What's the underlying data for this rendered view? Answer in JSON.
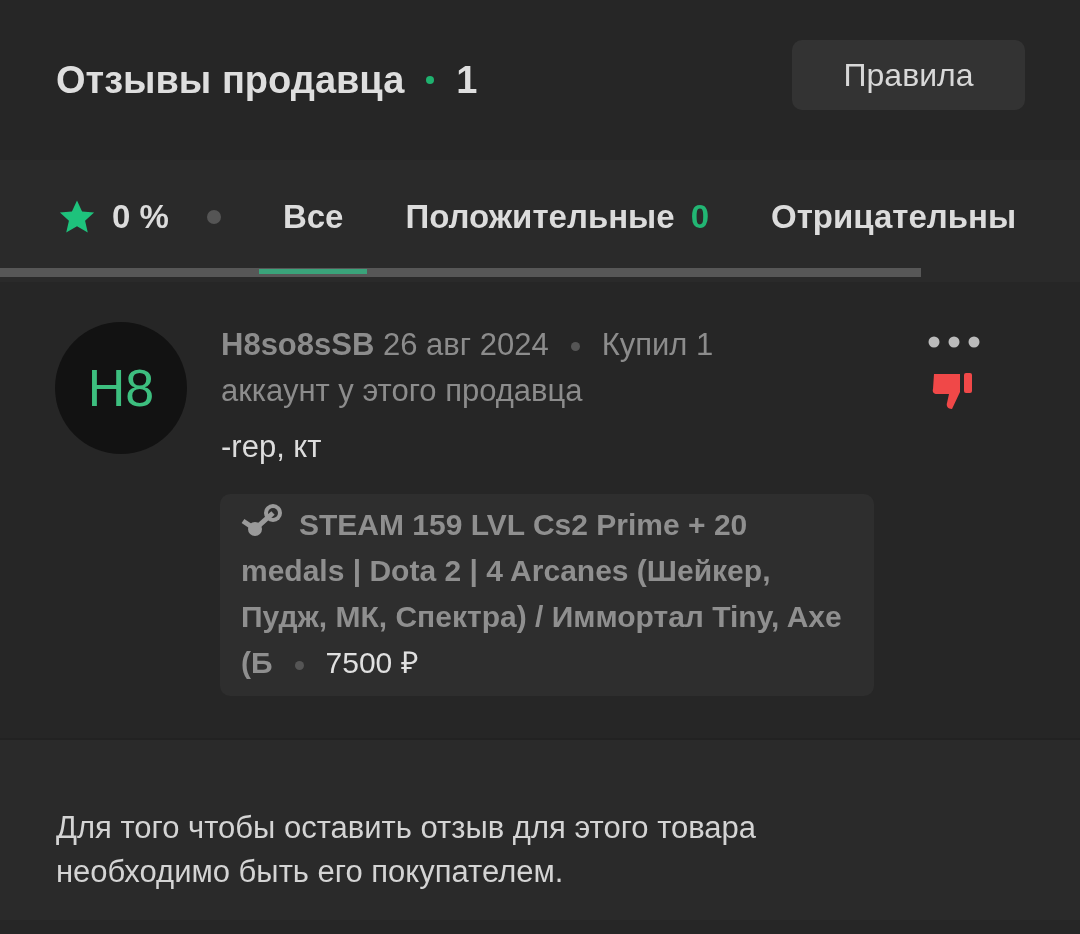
{
  "header": {
    "title": "Отзывы продавца",
    "count": "1",
    "rules_button": "Правила"
  },
  "filter_bar": {
    "rating": "0 %",
    "tabs": [
      {
        "label": "Все",
        "selected": true
      },
      {
        "label": "Положительные",
        "count": "0",
        "selected": false
      },
      {
        "label": "Отрицательны",
        "selected": false
      }
    ]
  },
  "reviews": [
    {
      "avatar": "H8",
      "author": "H8so8sSB",
      "date": "26 авг 2024",
      "purchase": "Купил 1 аккаунт у этого продавца",
      "text": "-rep, кт",
      "recommended": false,
      "product": {
        "title": "STEAM 159 LVL Cs2 Prime + 20 medals | Dota 2 | 4 Arcanes (Шейкер, Пудж, МК, Спектра) / Иммортал Tiny, Axe (Б",
        "price": "7500 ₽"
      }
    }
  ],
  "footer_note": "Для того чтобы оставить отзыв для этого товара необходимо быть его покупателем."
}
